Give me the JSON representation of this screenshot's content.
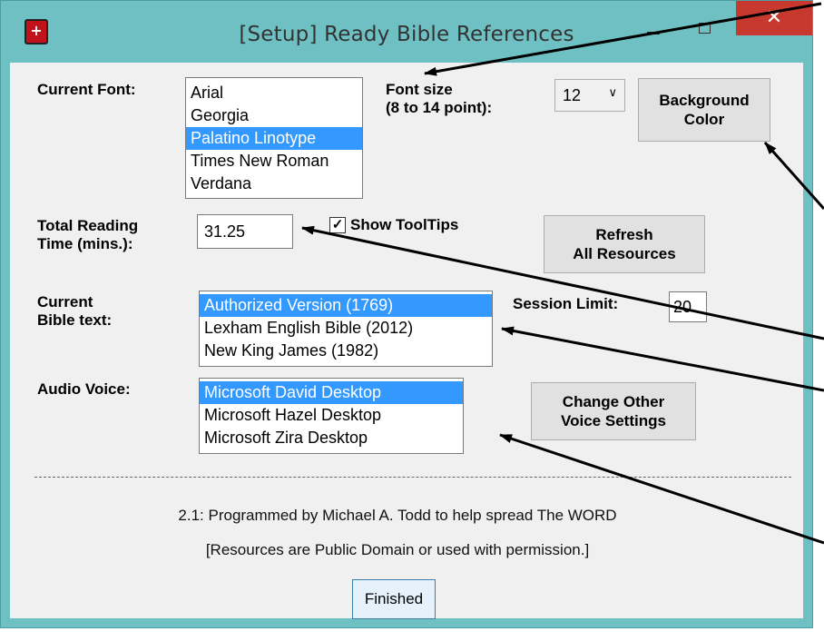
{
  "window": {
    "title": "[Setup] Ready Bible References",
    "app_icon_glyph": "+",
    "close_glyph": "✕"
  },
  "font": {
    "label": "Current Font:",
    "options": [
      "Arial",
      "Georgia",
      "Palatino Linotype",
      "Times New Roman",
      "Verdana"
    ],
    "selected_index": 2
  },
  "font_size": {
    "label_line1": "Font size",
    "label_line2": "(8 to 14 point):",
    "value": "12",
    "arrow_glyph": "∨"
  },
  "background_color_button": {
    "line1": "Background",
    "line2": "Color"
  },
  "reading_time": {
    "label_line1": "Total Reading",
    "label_line2": "Time (mins.):",
    "value": "31.25"
  },
  "tooltips": {
    "label": "Show ToolTips",
    "checked": true,
    "check_glyph": "✓"
  },
  "refresh_button": {
    "line1": "Refresh",
    "line2": "All Resources"
  },
  "bible_text": {
    "label_line1": "Current",
    "label_line2": "Bible text:",
    "options": [
      "Authorized Version (1769)",
      "Lexham English Bible (2012)",
      "New King James (1982)"
    ],
    "selected_index": 0
  },
  "session_limit": {
    "label": "Session Limit:",
    "value": "20"
  },
  "audio_voice": {
    "label": "Audio Voice:",
    "options": [
      "Microsoft David Desktop",
      "Microsoft Hazel Desktop",
      "Microsoft Zira Desktop"
    ],
    "selected_index": 0
  },
  "voice_settings_button": {
    "line1": "Change Other",
    "line2": "Voice Settings"
  },
  "footer": {
    "credit_line1": "2.1: Programmed by Michael A. Todd to help spread The WORD",
    "credit_line2": "[Resources are Public Domain or used with permission.]",
    "finished_label": "Finished"
  },
  "colors": {
    "window_frame": "#6fc0c3",
    "selection": "#3399ff",
    "close_button": "#c7392f"
  }
}
